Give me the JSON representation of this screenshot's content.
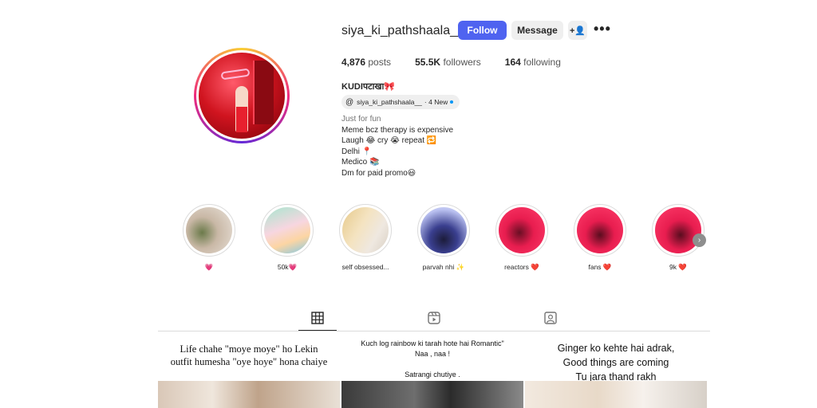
{
  "profile": {
    "username": "siya_ki_pathshaala__",
    "follow_label": "Follow",
    "message_label": "Message",
    "add_user_glyph": "+👤",
    "more_glyph": "•••",
    "stats": [
      {
        "count": "4,876",
        "label": "posts"
      },
      {
        "count": "55.5K",
        "label": "followers"
      },
      {
        "count": "164",
        "label": "following"
      }
    ],
    "name": "KUDIपटाखा🎀",
    "threads": {
      "handle": "siya_ki_pathshaala__",
      "suffix": "· 4 New",
      "icon": "threads-icon"
    },
    "category": "Just for fun",
    "bio_lines": [
      "Meme bcz therapy is expensive",
      "Laugh 😂 cry 😭 repeat 🔁",
      "Delhi 📍",
      "Medico 📚",
      "Dm for paid promo😃"
    ]
  },
  "highlights": [
    {
      "label": "💗"
    },
    {
      "label": "50k💗"
    },
    {
      "label": "self obsessed..."
    },
    {
      "label": "parvah nhi ✨"
    },
    {
      "label": "reactors ❤️"
    },
    {
      "label": "fans ❤️"
    },
    {
      "label": "9k ❤️"
    }
  ],
  "tabs": [
    {
      "name": "posts",
      "icon": "grid-icon",
      "active": true
    },
    {
      "name": "reels",
      "icon": "reels-icon",
      "active": false
    },
    {
      "name": "tagged",
      "icon": "tagged-icon",
      "active": false
    }
  ],
  "posts": [
    {
      "lines": [
        "Life chahe \"moye moye\" ho Lekin",
        "outfit humesha \"oye hoye\" hona chaiye"
      ]
    },
    {
      "lines": [
        "Kuch log rainbow ki tarah hote hai Romantic\"",
        "Naa , naa !",
        "",
        "Satrangi chutiye ."
      ]
    },
    {
      "lines": [
        "Ginger ko kehte hai adrak,",
        "Good things are coming",
        "Tu jara thand rakh"
      ]
    }
  ],
  "colors": {
    "accent": "#4f63f0",
    "text": "#262626",
    "muted": "#737373",
    "divider": "#dbdbdb"
  }
}
